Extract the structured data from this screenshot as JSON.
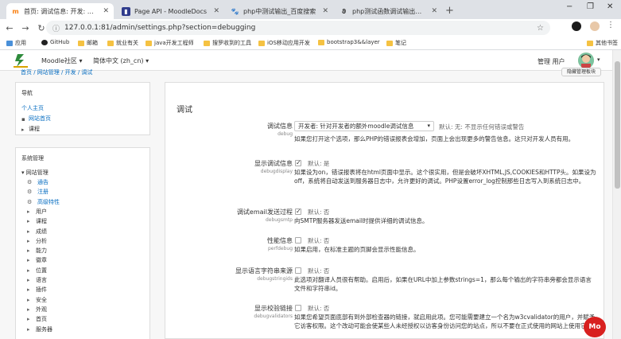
{
  "browser": {
    "tabs": [
      {
        "label": "首页: 调试信息: 开发: 调试",
        "favicon": "moodle-icon",
        "active": true
      },
      {
        "label": "Page API - MoodleDocs",
        "favicon": "moodledocs-icon",
        "active": false
      },
      {
        "label": "php中测试输出_百度搜索",
        "favicon": "baidu-icon",
        "active": false
      },
      {
        "label": "php测试函数调试输出方法 - 人生",
        "favicon": "blog-icon",
        "active": false
      }
    ],
    "new_tab": "+",
    "window_controls": {
      "minimize": "−",
      "maximize": "❐",
      "close": "✕"
    },
    "url": "127.0.0.1:81/admin/settings.php?section=debugging",
    "bookmarks": [
      "应用",
      "GitHub",
      "邮箱",
      "就业有关",
      "java开发工程师",
      "搜罗收到的工具",
      "iOS移动应用开发",
      "bootstrap3&&layer",
      "笔记",
      "其他书签"
    ]
  },
  "moodle_nav": {
    "community_menu": "Moodle社区 ▾",
    "language_menu": "简体中文 (zh_cn) ▾",
    "user_name": "管理 用户",
    "caret": "▾"
  },
  "breadcrumb": "首页 / 网站管理 / 开发 / 调试",
  "blocks_button": "隐藏管理板块",
  "nav_block": {
    "title": "导航",
    "items": [
      {
        "label": "个人主页",
        "icon": ""
      },
      {
        "label": "网站首页",
        "icon": "▪"
      },
      {
        "label": "课程",
        "icon": "▸"
      }
    ]
  },
  "admin_block": {
    "title": "系统管理",
    "root": "网站管理",
    "items": [
      {
        "label": "通告",
        "icon": "gear-icon"
      },
      {
        "label": "注册",
        "icon": "gear-icon"
      },
      {
        "label": "高级特性",
        "icon": "gear-icon"
      },
      {
        "label": "用户",
        "icon": "▸"
      },
      {
        "label": "课程",
        "icon": "▸"
      },
      {
        "label": "成绩",
        "icon": "▸"
      },
      {
        "label": "分析",
        "icon": "▸"
      },
      {
        "label": "能力",
        "icon": "▸"
      },
      {
        "label": "徽章",
        "icon": "▸"
      },
      {
        "label": "位置",
        "icon": "▸"
      },
      {
        "label": "语言",
        "icon": "▸"
      },
      {
        "label": "插件",
        "icon": "▸"
      },
      {
        "label": "安全",
        "icon": "▸"
      },
      {
        "label": "外观",
        "icon": "▸"
      },
      {
        "label": "首页",
        "icon": "▸"
      },
      {
        "label": "服务器",
        "icon": "▸"
      }
    ]
  },
  "main": {
    "title": "调试",
    "settings": [
      {
        "label": "调试信息",
        "name": "debug",
        "type": "select",
        "value": "开发者: 针对开发者的额外moodle调试信息",
        "default": "默认: 无: 不显示任何错误或警告",
        "desc": "如果您打开这个选项，那么PHP的错误报表会增加，页面上会出现更多的警告信息。这只对开发人员有用。"
      },
      {
        "label": "显示调试信息",
        "name": "debugdisplay",
        "type": "checkbox",
        "checked": true,
        "default": "默认: 是",
        "desc": "如果设为on，错误报表将在html页面中显示。这个很实用，但是会破坏XHTML,JS,COOKIES和HTTP头。如果设为off，系统将自动发送到服务器日志中，允许更好的调试。PHP设置error_log控制那些日志写入到系统日志中。"
      },
      {
        "label": "调试email发送过程",
        "name": "debugsmtp",
        "type": "checkbox",
        "checked": true,
        "default": "默认: 否",
        "desc": "向SMTP服务器发送email时提供详细的调试信息。"
      },
      {
        "label": "性能信息",
        "name": "perfdebug",
        "type": "checkbox",
        "checked": false,
        "default": "默认: 否",
        "desc": "如果启用，在标准主题的页脚会显示性能信息。"
      },
      {
        "label": "显示语言字符串来源",
        "name": "debugstringids",
        "type": "checkbox",
        "checked": false,
        "default": "默认: 否",
        "desc": "此选项对翻译人员很有帮助。启用后，如果在URL中加上参数strings=1，那么每个输出的字符串旁都会显示语言文件和字符串id。"
      },
      {
        "label": "显示校验链接",
        "name": "debugvalidators",
        "type": "checkbox",
        "checked": false,
        "default": "默认: 否",
        "desc": "如果您希望页面底部有到外部检查器的链接，就启用此项。您可能需要建立一个名为w3cvalidator的用户，并赋予它访客权限。这个改动可能会使某些人未经授权以访客身份访问您的站点，所以不要在正式使用的网站上使用它。"
      }
    ]
  },
  "floating_icon": "Mo"
}
